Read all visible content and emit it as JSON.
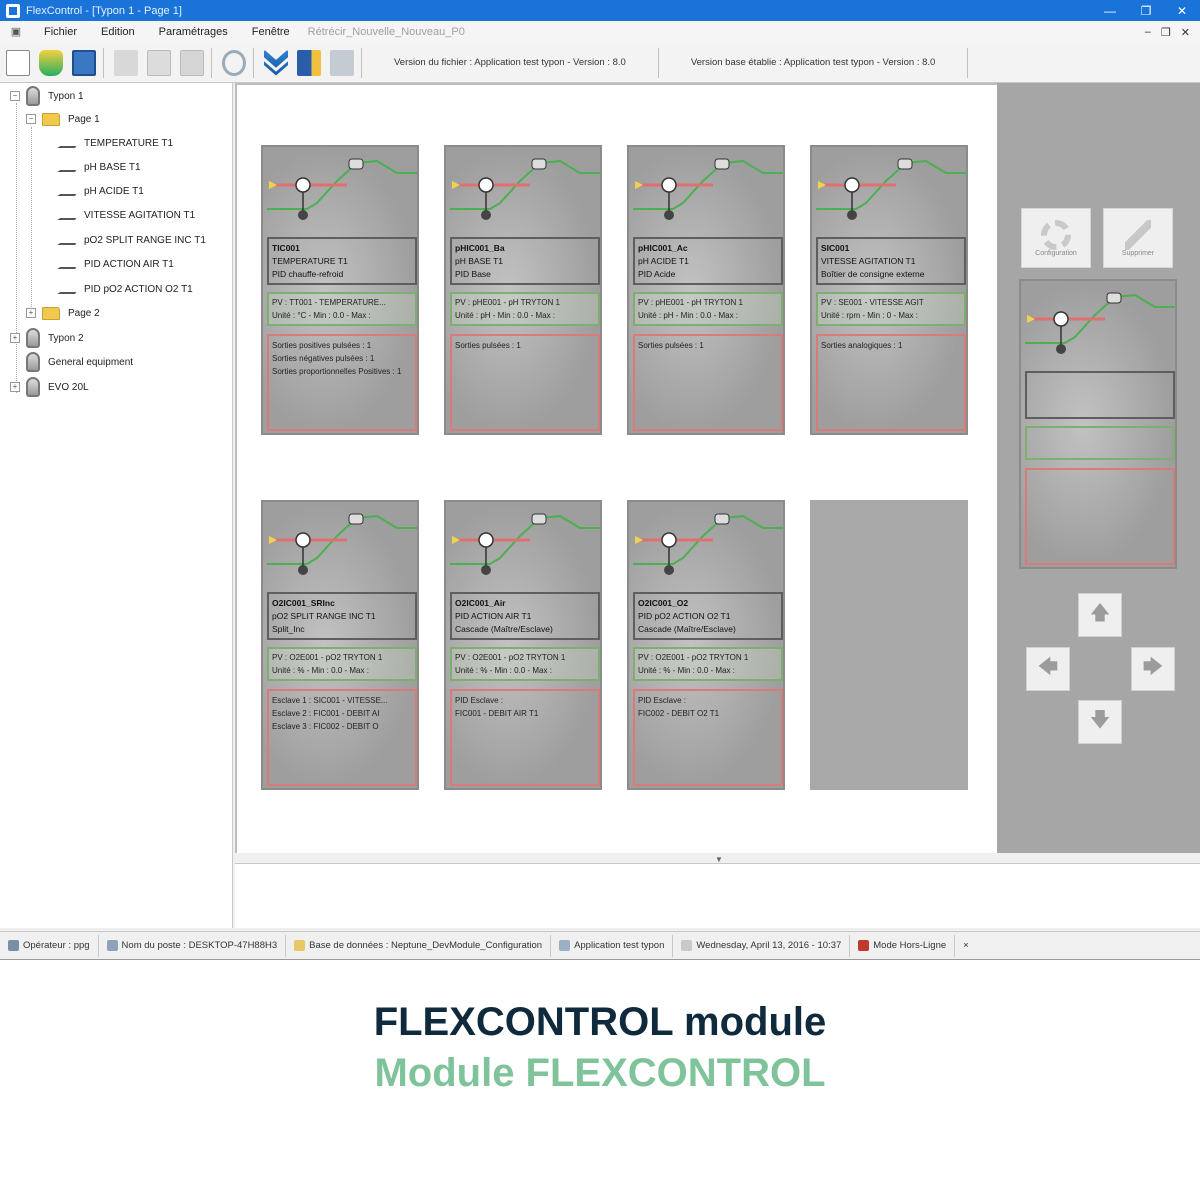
{
  "window": {
    "title": "FlexControl - [Typon 1 - Page 1]",
    "minimize": "—",
    "maximize": "❐",
    "close": "✕"
  },
  "menu": {
    "items": [
      "Fichier",
      "Edition",
      "Paramétrages",
      "Fenêtre"
    ],
    "mdi_title": "Rétrécir_Nouvelle_Nouveau_P0",
    "mdi_controls": [
      "–",
      "❐",
      "✕"
    ]
  },
  "toolbar": {
    "version_file": "Version du fichier : Application test typon - Version : 8.0",
    "version_db": "Version base établie : Application test typon - Version : 8.0"
  },
  "tree": {
    "items": [
      {
        "label": "Typon 1",
        "expander": "−"
      },
      {
        "label": "Page 1",
        "expander": "−"
      },
      {
        "label": "TEMPERATURE T1"
      },
      {
        "label": "pH BASE T1"
      },
      {
        "label": "pH ACIDE T1"
      },
      {
        "label": "VITESSE AGITATION T1"
      },
      {
        "label": "pO2 SPLIT RANGE INC T1"
      },
      {
        "label": "PID ACTION AIR T1"
      },
      {
        "label": "PID pO2 ACTION O2 T1"
      },
      {
        "label": "Page 2",
        "expander": "+"
      },
      {
        "label": "Typon 2",
        "expander": "+"
      },
      {
        "label": "General equipment"
      },
      {
        "label": "EVO 20L",
        "expander": "+"
      }
    ]
  },
  "cards": [
    {
      "l1": "TIC001",
      "l2": "TEMPERATURE T1",
      "l3": "PID chauffe-refroid",
      "pv1": "PV : TT001 - TEMPERATURE...",
      "pv2": "Unité : °C - Min : 0.0 - Max :",
      "io": [
        "Sorties positives pulsées : 1",
        "Sorties négatives pulsées : 1",
        "Sorties proportionnelles Positives : 1"
      ]
    },
    {
      "l1": "pHIC001_Ba",
      "l2": "pH BASE T1",
      "l3": "PID Base",
      "pv1": "PV : pHE001 - pH TRYTON 1",
      "pv2": "Unité : pH - Min : 0.0 - Max :",
      "io": [
        "Sorties pulsées : 1"
      ]
    },
    {
      "l1": "pHIC001_Ac",
      "l2": "pH ACIDE T1",
      "l3": "PID Acide",
      "pv1": "PV : pHE001 - pH TRYTON 1",
      "pv2": "Unité : pH - Min : 0.0 - Max :",
      "io": [
        "Sorties pulsées : 1"
      ]
    },
    {
      "l1": "SIC001",
      "l2": "VITESSE AGITATION T1",
      "l3": "Boîtier de consigne externe",
      "pv1": "PV : SE001 - VITESSE AGIT",
      "pv2": "Unité : rpm - Min : 0 - Max :",
      "io": [
        "Sorties analogiques : 1"
      ]
    },
    {
      "l1": "O2IC001_SRInc",
      "l2": "pO2 SPLIT RANGE INC T1",
      "l3": "Split_Inc",
      "pv1": "PV : O2E001 - pO2 TRYTON 1",
      "pv2": "Unité : % - Min : 0.0 - Max :",
      "io": [
        "Esclave 1 : SIC001 - VITESSE...",
        "Esclave 2 : FIC001 - DEBIT AI",
        "Esclave 3 : FIC002 - DEBIT O"
      ]
    },
    {
      "l1": "O2IC001_Air",
      "l2": "PID ACTION AIR T1",
      "l3": "Cascade (Maître/Esclave)",
      "pv1": "PV : O2E001 - pO2 TRYTON 1",
      "pv2": "Unité : % - Min : 0.0 - Max :",
      "io": [
        "PID Esclave :",
        "FIC001 - DEBIT AIR T1"
      ]
    },
    {
      "l1": "O2IC001_O2",
      "l2": "PID pO2 ACTION O2 T1",
      "l3": "Cascade (Maître/Esclave)",
      "pv1": "PV : O2E001 - pO2 TRYTON 1",
      "pv2": "Unité : % - Min : 0.0 - Max :",
      "io": [
        "PID Esclave :",
        "FIC002 - DEBIT O2 T1"
      ]
    }
  ],
  "palette": {
    "configure_label": "Configuration",
    "edit_label": "Supprimer",
    "arrows": {
      "up": "🡅",
      "left": "🡄",
      "right": "🡆",
      "down": "🡇"
    }
  },
  "scroll_arrow": "▼",
  "status": {
    "operator": "Opérateur : ppg",
    "station": "Nom du poste : DESKTOP-47H88H3",
    "database": "Base de données : Neptune_DevModule_Configuration",
    "application": "Application test typon",
    "datetime": "Wednesday, April 13, 2016 - 10:37",
    "mode": "Mode Hors-Ligne",
    "close": "×"
  },
  "captions": {
    "en": "FLEXCONTROL module",
    "fr": "Module FLEXCONTROL"
  },
  "colors": {
    "titlebar": "#1a73d8",
    "caption_dark": "#0f2a3d",
    "caption_green": "#7fc39a",
    "card_pv_border": "#7fae73",
    "card_io_border": "#d97b7b"
  }
}
